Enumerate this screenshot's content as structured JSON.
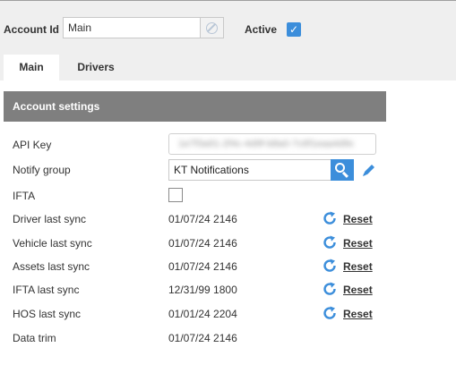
{
  "header": {
    "account_id_label": "Account Id",
    "account_id_value": "Main",
    "active_label": "Active",
    "active_checked": true
  },
  "tabs": [
    {
      "label": "Main",
      "active": true
    },
    {
      "label": "Drivers",
      "active": false
    }
  ],
  "panel": {
    "title": "Account settings",
    "api_key_label": "API Key",
    "api_key_value": "1e7f3a91-2f4c-4d9f-b8a0-7c6f1eaa4d9c",
    "notify_group_label": "Notify group",
    "notify_group_value": "KT Notifications",
    "ifta_label": "IFTA",
    "ifta_checked": false,
    "sync_rows": [
      {
        "label": "Driver last sync",
        "value": "01/07/24 2146",
        "reset": "Reset"
      },
      {
        "label": "Vehicle last sync",
        "value": "01/07/24 2146",
        "reset": "Reset"
      },
      {
        "label": "Assets last sync",
        "value": "01/07/24 2146",
        "reset": "Reset"
      },
      {
        "label": "IFTA last sync",
        "value": "12/31/99 1800",
        "reset": "Reset"
      },
      {
        "label": "HOS last sync",
        "value": "01/01/24 2204",
        "reset": "Reset"
      }
    ],
    "data_trim_label": "Data trim",
    "data_trim_value": "01/07/24 2146"
  },
  "colors": {
    "accent": "#3c8edb",
    "panel_header_bg": "#7f7f7f",
    "header_bg": "#efefef"
  },
  "icons": [
    "link-icon",
    "check-icon",
    "search-icon",
    "pencil-icon",
    "refresh-icon"
  ]
}
